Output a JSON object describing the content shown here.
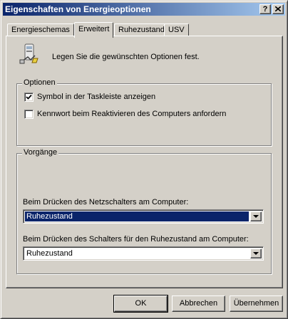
{
  "window": {
    "title": "Eigenschaften von Energieoptionen",
    "help_button": "?",
    "close_button": "x"
  },
  "tabs": [
    {
      "label": "Energieschemas",
      "active": false
    },
    {
      "label": "Erweitert",
      "active": true
    },
    {
      "label": "Ruhezustand",
      "active": false
    },
    {
      "label": "USV",
      "active": false
    }
  ],
  "intro": {
    "text": "Legen Sie die gewünschten Optionen fest.",
    "icon": "power-options-icon"
  },
  "options_group": {
    "label": "Optionen",
    "checkboxes": [
      {
        "label": "Symbol in der Taskleiste anzeigen",
        "checked": true
      },
      {
        "label": "Kennwort beim Reaktivieren des Computers anfordern",
        "checked": false
      }
    ]
  },
  "actions_group": {
    "label": "Vorgänge",
    "power_button": {
      "label": "Beim Drücken des Netzschalters am Computer:",
      "value": "Ruhezustand"
    },
    "sleep_button": {
      "label": "Beim Drücken des Schalters für den Ruhezustand am Computer:",
      "value": "Ruhezustand"
    }
  },
  "buttons": {
    "ok": "OK",
    "cancel": "Abbrechen",
    "apply": "Übernehmen"
  },
  "colors": {
    "title_active": "#0a246a",
    "face": "#d4d0c8",
    "selection": "#0a246a"
  }
}
